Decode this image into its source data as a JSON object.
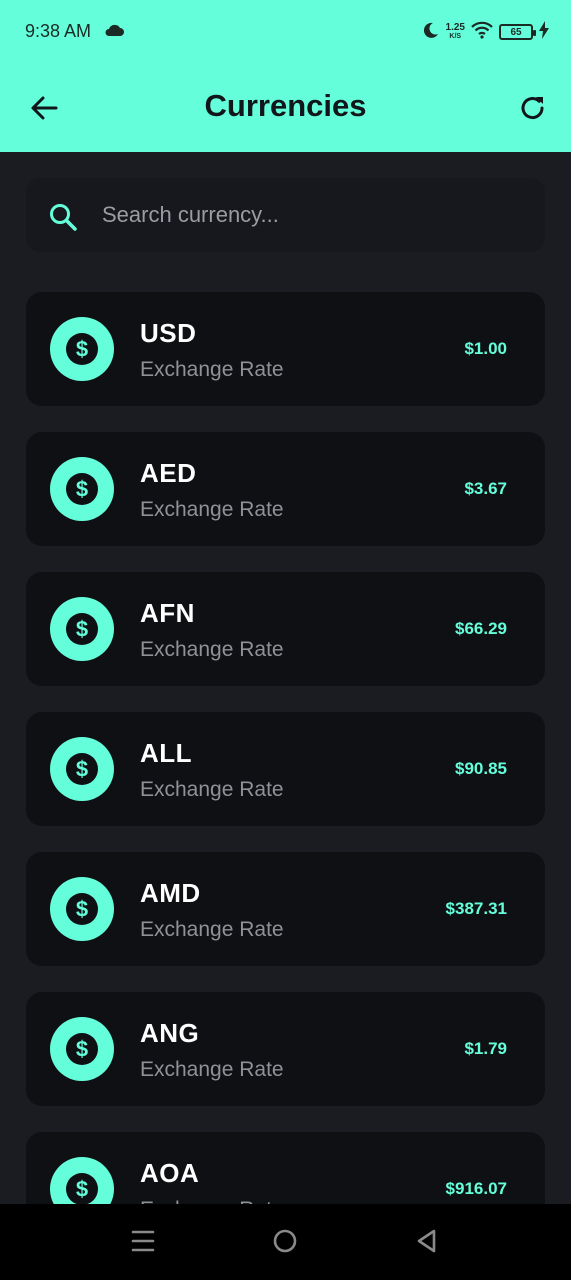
{
  "status_bar": {
    "time": "9:38 AM",
    "speed_value": "1.25",
    "speed_unit": "K/S",
    "battery": "65",
    "icons": [
      "cloud-icon",
      "moon-icon",
      "wifi-icon",
      "battery-icon",
      "charging-bolt-icon"
    ]
  },
  "app_bar": {
    "title": "Currencies",
    "back_icon": "arrow-left-icon",
    "refresh_icon": "refresh-icon"
  },
  "search": {
    "placeholder": "Search currency...",
    "value": "",
    "icon": "search-icon"
  },
  "currencies": [
    {
      "code": "USD",
      "subtitle": "Exchange Rate",
      "rate": "$1.00"
    },
    {
      "code": "AED",
      "subtitle": "Exchange Rate",
      "rate": "$3.67"
    },
    {
      "code": "AFN",
      "subtitle": "Exchange Rate",
      "rate": "$66.29"
    },
    {
      "code": "ALL",
      "subtitle": "Exchange Rate",
      "rate": "$90.85"
    },
    {
      "code": "AMD",
      "subtitle": "Exchange Rate",
      "rate": "$387.31"
    },
    {
      "code": "ANG",
      "subtitle": "Exchange Rate",
      "rate": "$1.79"
    },
    {
      "code": "AOA",
      "subtitle": "Exchange Rate",
      "rate": "$916.07"
    }
  ],
  "nav_bar": {
    "icons": [
      "menu-icon",
      "home-circle-icon",
      "back-triangle-icon"
    ]
  },
  "colors": {
    "accent": "#64ffda",
    "background": "#1a1c22",
    "card": "#0f1014",
    "title_text": "#10161a"
  }
}
